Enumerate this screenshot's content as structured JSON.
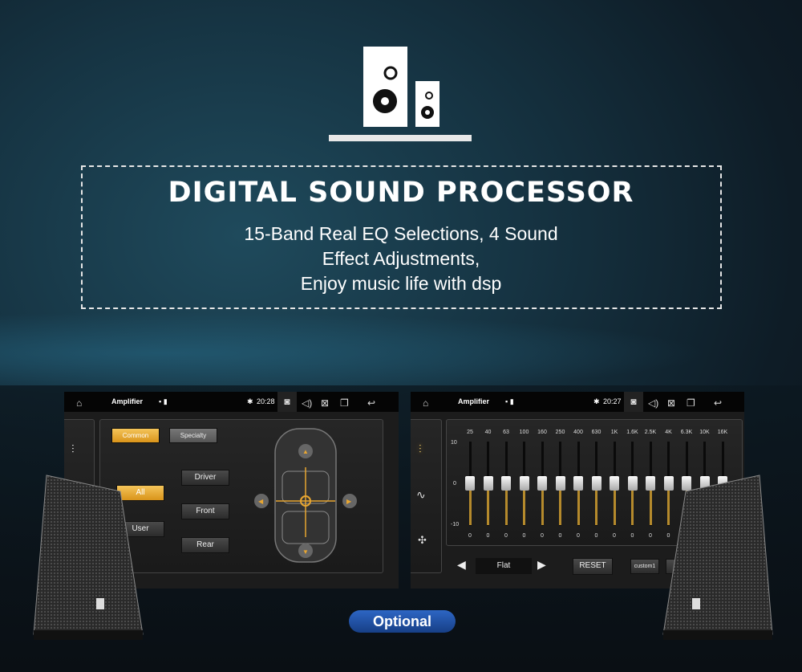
{
  "header": {
    "title": "DIGITAL SOUND PROCESSOR",
    "subtitle_lines": [
      "15-Band Real EQ Selections, 4 Sound",
      "Effect Adjustments,",
      "Enjoy music life with dsp"
    ],
    "icon": "speaker-icon"
  },
  "left_screen": {
    "app_title": "Amplifier",
    "time": "20:28",
    "tabs": [
      "Common",
      "Specialty"
    ],
    "modes": [
      "All",
      "User"
    ],
    "zones": [
      "Driver",
      "Front",
      "Rear"
    ]
  },
  "right_screen": {
    "app_title": "Amplifier",
    "time": "20:27",
    "scale": [
      "10",
      "0",
      "-10"
    ],
    "bands": [
      {
        "f": "25",
        "v": "0"
      },
      {
        "f": "40",
        "v": "0"
      },
      {
        "f": "63",
        "v": "0"
      },
      {
        "f": "100",
        "v": "0"
      },
      {
        "f": "160",
        "v": "0"
      },
      {
        "f": "250",
        "v": "0"
      },
      {
        "f": "400",
        "v": "0"
      },
      {
        "f": "630",
        "v": "0"
      },
      {
        "f": "1K",
        "v": "0"
      },
      {
        "f": "1.6K",
        "v": "0"
      },
      {
        "f": "2.5K",
        "v": "0"
      },
      {
        "f": "4K",
        "v": "0"
      },
      {
        "f": "6.3K",
        "v": "0"
      },
      {
        "f": "10K",
        "v": "0"
      },
      {
        "f": "16K",
        "v": "0"
      }
    ],
    "preset": "Flat",
    "reset": "RESET",
    "custom": "custom1"
  },
  "badge": "Optional",
  "colors": {
    "accent": "#e8a631",
    "badge": "#1f4f9e"
  }
}
